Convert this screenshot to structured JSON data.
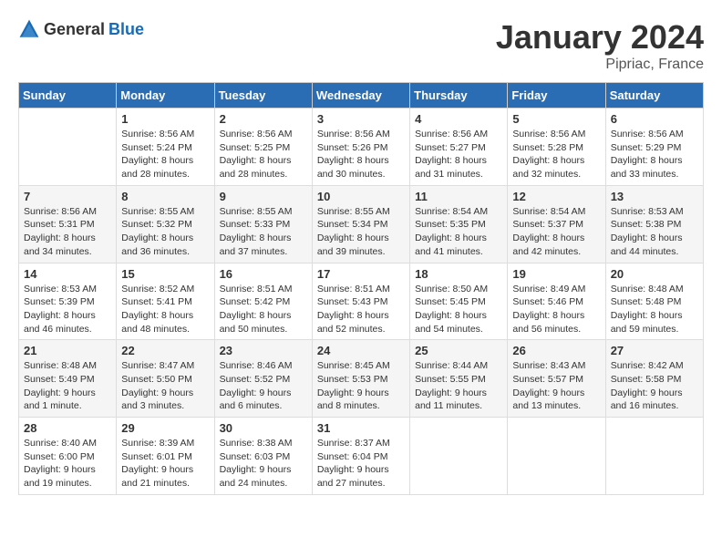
{
  "header": {
    "logo_general": "General",
    "logo_blue": "Blue",
    "month_title": "January 2024",
    "location": "Pipriac, France"
  },
  "days_of_week": [
    "Sunday",
    "Monday",
    "Tuesday",
    "Wednesday",
    "Thursday",
    "Friday",
    "Saturday"
  ],
  "weeks": [
    [
      {
        "day": "",
        "sunrise": "",
        "sunset": "",
        "daylight": ""
      },
      {
        "day": "1",
        "sunrise": "Sunrise: 8:56 AM",
        "sunset": "Sunset: 5:24 PM",
        "daylight": "Daylight: 8 hours and 28 minutes."
      },
      {
        "day": "2",
        "sunrise": "Sunrise: 8:56 AM",
        "sunset": "Sunset: 5:25 PM",
        "daylight": "Daylight: 8 hours and 28 minutes."
      },
      {
        "day": "3",
        "sunrise": "Sunrise: 8:56 AM",
        "sunset": "Sunset: 5:26 PM",
        "daylight": "Daylight: 8 hours and 30 minutes."
      },
      {
        "day": "4",
        "sunrise": "Sunrise: 8:56 AM",
        "sunset": "Sunset: 5:27 PM",
        "daylight": "Daylight: 8 hours and 31 minutes."
      },
      {
        "day": "5",
        "sunrise": "Sunrise: 8:56 AM",
        "sunset": "Sunset: 5:28 PM",
        "daylight": "Daylight: 8 hours and 32 minutes."
      },
      {
        "day": "6",
        "sunrise": "Sunrise: 8:56 AM",
        "sunset": "Sunset: 5:29 PM",
        "daylight": "Daylight: 8 hours and 33 minutes."
      }
    ],
    [
      {
        "day": "7",
        "sunrise": "Sunrise: 8:56 AM",
        "sunset": "Sunset: 5:31 PM",
        "daylight": "Daylight: 8 hours and 34 minutes."
      },
      {
        "day": "8",
        "sunrise": "Sunrise: 8:55 AM",
        "sunset": "Sunset: 5:32 PM",
        "daylight": "Daylight: 8 hours and 36 minutes."
      },
      {
        "day": "9",
        "sunrise": "Sunrise: 8:55 AM",
        "sunset": "Sunset: 5:33 PM",
        "daylight": "Daylight: 8 hours and 37 minutes."
      },
      {
        "day": "10",
        "sunrise": "Sunrise: 8:55 AM",
        "sunset": "Sunset: 5:34 PM",
        "daylight": "Daylight: 8 hours and 39 minutes."
      },
      {
        "day": "11",
        "sunrise": "Sunrise: 8:54 AM",
        "sunset": "Sunset: 5:35 PM",
        "daylight": "Daylight: 8 hours and 41 minutes."
      },
      {
        "day": "12",
        "sunrise": "Sunrise: 8:54 AM",
        "sunset": "Sunset: 5:37 PM",
        "daylight": "Daylight: 8 hours and 42 minutes."
      },
      {
        "day": "13",
        "sunrise": "Sunrise: 8:53 AM",
        "sunset": "Sunset: 5:38 PM",
        "daylight": "Daylight: 8 hours and 44 minutes."
      }
    ],
    [
      {
        "day": "14",
        "sunrise": "Sunrise: 8:53 AM",
        "sunset": "Sunset: 5:39 PM",
        "daylight": "Daylight: 8 hours and 46 minutes."
      },
      {
        "day": "15",
        "sunrise": "Sunrise: 8:52 AM",
        "sunset": "Sunset: 5:41 PM",
        "daylight": "Daylight: 8 hours and 48 minutes."
      },
      {
        "day": "16",
        "sunrise": "Sunrise: 8:51 AM",
        "sunset": "Sunset: 5:42 PM",
        "daylight": "Daylight: 8 hours and 50 minutes."
      },
      {
        "day": "17",
        "sunrise": "Sunrise: 8:51 AM",
        "sunset": "Sunset: 5:43 PM",
        "daylight": "Daylight: 8 hours and 52 minutes."
      },
      {
        "day": "18",
        "sunrise": "Sunrise: 8:50 AM",
        "sunset": "Sunset: 5:45 PM",
        "daylight": "Daylight: 8 hours and 54 minutes."
      },
      {
        "day": "19",
        "sunrise": "Sunrise: 8:49 AM",
        "sunset": "Sunset: 5:46 PM",
        "daylight": "Daylight: 8 hours and 56 minutes."
      },
      {
        "day": "20",
        "sunrise": "Sunrise: 8:48 AM",
        "sunset": "Sunset: 5:48 PM",
        "daylight": "Daylight: 8 hours and 59 minutes."
      }
    ],
    [
      {
        "day": "21",
        "sunrise": "Sunrise: 8:48 AM",
        "sunset": "Sunset: 5:49 PM",
        "daylight": "Daylight: 9 hours and 1 minute."
      },
      {
        "day": "22",
        "sunrise": "Sunrise: 8:47 AM",
        "sunset": "Sunset: 5:50 PM",
        "daylight": "Daylight: 9 hours and 3 minutes."
      },
      {
        "day": "23",
        "sunrise": "Sunrise: 8:46 AM",
        "sunset": "Sunset: 5:52 PM",
        "daylight": "Daylight: 9 hours and 6 minutes."
      },
      {
        "day": "24",
        "sunrise": "Sunrise: 8:45 AM",
        "sunset": "Sunset: 5:53 PM",
        "daylight": "Daylight: 9 hours and 8 minutes."
      },
      {
        "day": "25",
        "sunrise": "Sunrise: 8:44 AM",
        "sunset": "Sunset: 5:55 PM",
        "daylight": "Daylight: 9 hours and 11 minutes."
      },
      {
        "day": "26",
        "sunrise": "Sunrise: 8:43 AM",
        "sunset": "Sunset: 5:57 PM",
        "daylight": "Daylight: 9 hours and 13 minutes."
      },
      {
        "day": "27",
        "sunrise": "Sunrise: 8:42 AM",
        "sunset": "Sunset: 5:58 PM",
        "daylight": "Daylight: 9 hours and 16 minutes."
      }
    ],
    [
      {
        "day": "28",
        "sunrise": "Sunrise: 8:40 AM",
        "sunset": "Sunset: 6:00 PM",
        "daylight": "Daylight: 9 hours and 19 minutes."
      },
      {
        "day": "29",
        "sunrise": "Sunrise: 8:39 AM",
        "sunset": "Sunset: 6:01 PM",
        "daylight": "Daylight: 9 hours and 21 minutes."
      },
      {
        "day": "30",
        "sunrise": "Sunrise: 8:38 AM",
        "sunset": "Sunset: 6:03 PM",
        "daylight": "Daylight: 9 hours and 24 minutes."
      },
      {
        "day": "31",
        "sunrise": "Sunrise: 8:37 AM",
        "sunset": "Sunset: 6:04 PM",
        "daylight": "Daylight: 9 hours and 27 minutes."
      },
      {
        "day": "",
        "sunrise": "",
        "sunset": "",
        "daylight": ""
      },
      {
        "day": "",
        "sunrise": "",
        "sunset": "",
        "daylight": ""
      },
      {
        "day": "",
        "sunrise": "",
        "sunset": "",
        "daylight": ""
      }
    ]
  ]
}
